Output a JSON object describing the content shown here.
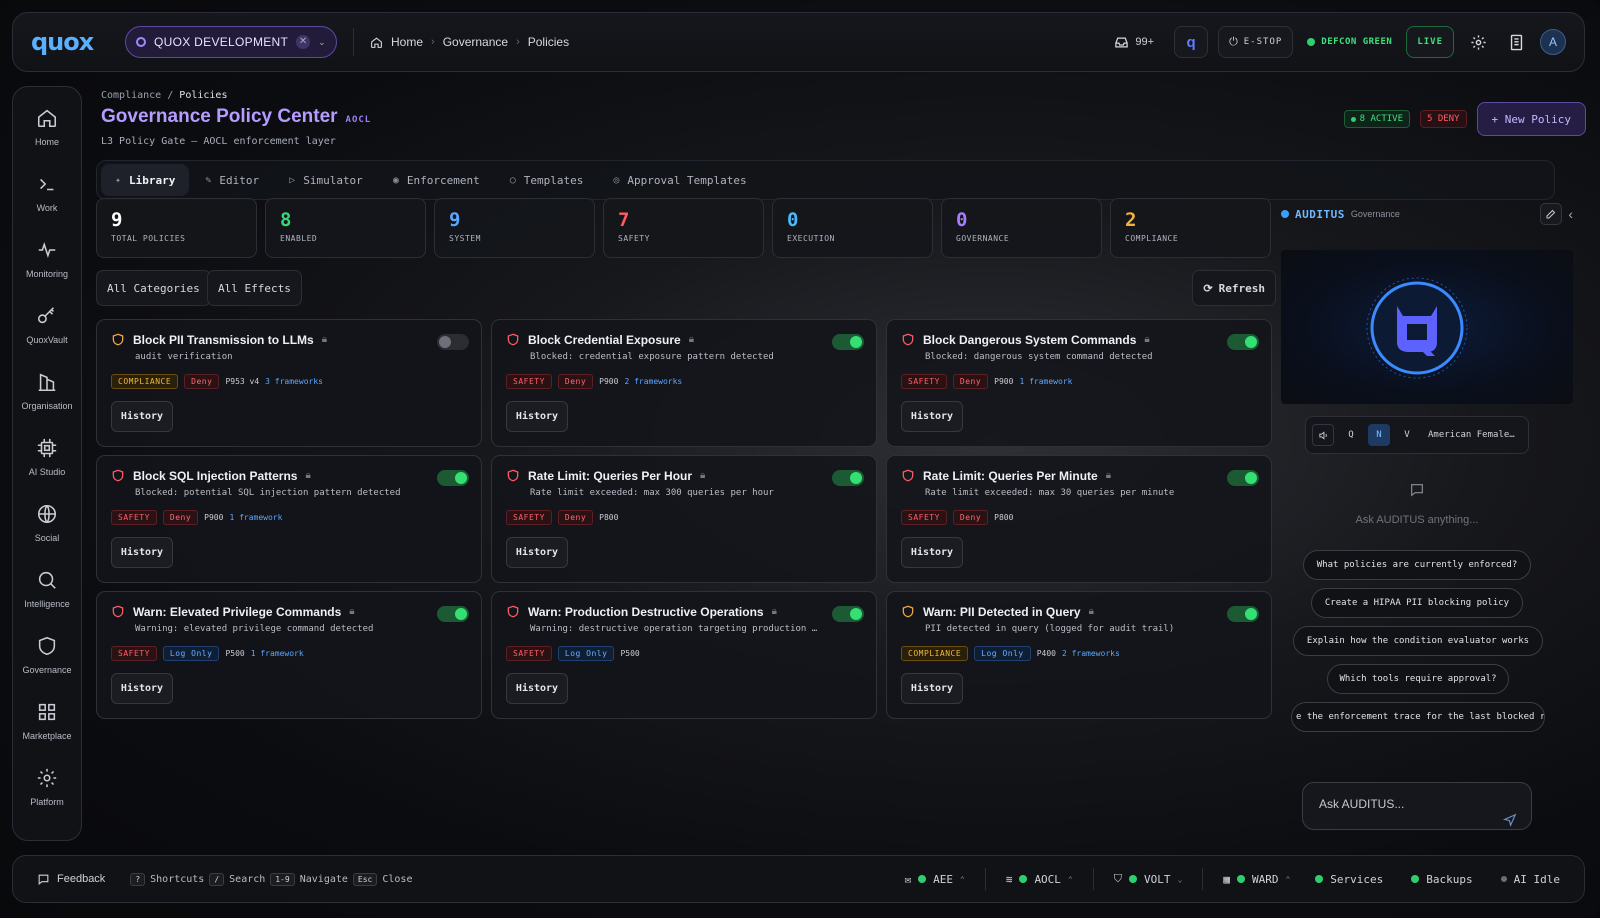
{
  "topbar": {
    "logo": "quox",
    "workspace": "QUOX DEVELOPMENT",
    "breadcrumbs": [
      "Home",
      "Governance",
      "Policies"
    ],
    "notifications": "99+",
    "estop": "E-STOP",
    "defcon": "DEFCON GREEN",
    "live": "LIVE",
    "avatar": "A"
  },
  "sidebar": {
    "items": [
      {
        "label": "Home",
        "icon": "home-icon"
      },
      {
        "label": "Work",
        "icon": "terminal-icon"
      },
      {
        "label": "Monitoring",
        "icon": "pulse-icon"
      },
      {
        "label": "QuoxVault",
        "icon": "key-icon"
      },
      {
        "label": "Organisation",
        "icon": "building-icon"
      },
      {
        "label": "AI Studio",
        "icon": "chip-icon"
      },
      {
        "label": "Social",
        "icon": "globe-icon"
      },
      {
        "label": "Intelligence",
        "icon": "search-icon"
      },
      {
        "label": "Governance",
        "icon": "shield-icon"
      },
      {
        "label": "Marketplace",
        "icon": "grid-icon"
      },
      {
        "label": "Platform",
        "icon": "gear-icon"
      }
    ]
  },
  "page": {
    "breadcrumb_parent": "Compliance",
    "breadcrumb_current": "Policies",
    "title": "Governance Policy Center",
    "title_tag": "AOCL",
    "subtitle": "L3 Policy Gate — AOCL enforcement layer",
    "active_badge": "8 ACTIVE",
    "deny_badge": "5 DENY",
    "new_policy": "+ New Policy"
  },
  "tabs": [
    {
      "label": "Library",
      "icon": "✦"
    },
    {
      "label": "Editor",
      "icon": "✎"
    },
    {
      "label": "Simulator",
      "icon": "▷"
    },
    {
      "label": "Enforcement",
      "icon": "◉"
    },
    {
      "label": "Templates",
      "icon": "○"
    },
    {
      "label": "Approval Templates",
      "icon": "◎"
    }
  ],
  "stats": [
    {
      "value": "9",
      "label": "TOTAL POLICIES",
      "color": "#ffffff"
    },
    {
      "value": "8",
      "label": "ENABLED",
      "color": "#35d874"
    },
    {
      "value": "9",
      "label": "SYSTEM",
      "color": "#59a8ff"
    },
    {
      "value": "7",
      "label": "SAFETY",
      "color": "#ff5a63"
    },
    {
      "value": "0",
      "label": "EXECUTION",
      "color": "#4ab8ff"
    },
    {
      "value": "0",
      "label": "GOVERNANCE",
      "color": "#a67dff"
    },
    {
      "value": "2",
      "label": "COMPLIANCE",
      "color": "#f2b23a"
    }
  ],
  "filters": {
    "categories": "All Categories",
    "effects": "All Effects",
    "refresh": "Refresh"
  },
  "policies": [
    {
      "title": "Block PII Transmission to LLMs",
      "desc": "audit verification",
      "category": "COMPLIANCE",
      "effect": "Deny",
      "code": "P953 v4",
      "frameworks": "3 frameworks",
      "enabled": false
    },
    {
      "title": "Block Credential Exposure",
      "desc": "Blocked: credential exposure pattern detected",
      "category": "SAFETY",
      "effect": "Deny",
      "code": "P900",
      "frameworks": "2 frameworks",
      "enabled": true
    },
    {
      "title": "Block Dangerous System Commands",
      "desc": "Blocked: dangerous system command detected",
      "category": "SAFETY",
      "effect": "Deny",
      "code": "P900",
      "frameworks": "1 framework",
      "enabled": true
    },
    {
      "title": "Block SQL Injection Patterns",
      "desc": "Blocked: potential SQL injection pattern detected",
      "category": "SAFETY",
      "effect": "Deny",
      "code": "P900",
      "frameworks": "1 framework",
      "enabled": true
    },
    {
      "title": "Rate Limit: Queries Per Hour",
      "desc": "Rate limit exceeded: max 300 queries per hour",
      "category": "SAFETY",
      "effect": "Deny",
      "code": "P800",
      "frameworks": "",
      "enabled": true
    },
    {
      "title": "Rate Limit: Queries Per Minute",
      "desc": "Rate limit exceeded: max 30 queries per minute",
      "category": "SAFETY",
      "effect": "Deny",
      "code": "P800",
      "frameworks": "",
      "enabled": true
    },
    {
      "title": "Warn: Elevated Privilege Commands",
      "desc": "Warning: elevated privilege command detected",
      "category": "SAFETY",
      "effect": "Log Only",
      "code": "P500",
      "frameworks": "1 framework",
      "enabled": true
    },
    {
      "title": "Warn: Production Destructive Operations",
      "desc": "Warning: destructive operation targeting production …",
      "category": "SAFETY",
      "effect": "Log Only",
      "code": "P500",
      "frameworks": "",
      "enabled": true
    },
    {
      "title": "Warn: PII Detected in Query",
      "desc": "PII detected in query (logged for audit trail)",
      "category": "COMPLIANCE",
      "effect": "Log Only",
      "code": "P400",
      "frameworks": "2 frameworks",
      "enabled": true
    }
  ],
  "history_label": "History",
  "auditus": {
    "name": "AUDITUS",
    "context": "Governance",
    "voice_keys": [
      "Q",
      "N",
      "V"
    ],
    "voice_name": "American Female…",
    "hint": "Ask AUDITUS anything...",
    "suggestions": [
      "What policies are currently enforced?",
      "Create a HIPAA PII blocking policy",
      "Explain how the condition evaluator works",
      "Which tools require approval?",
      "e the enforcement trace for the last blocked r"
    ],
    "input_placeholder": "Ask AUDITUS..."
  },
  "footer": {
    "feedback": "Feedback",
    "shortcuts": [
      {
        "key": "?",
        "label": "Shortcuts"
      },
      {
        "key": "/",
        "label": "Search"
      },
      {
        "key": "1-9",
        "label": "Navigate"
      },
      {
        "key": "Esc",
        "label": "Close"
      }
    ],
    "services": [
      {
        "label": "AEE",
        "icon": "mail-icon"
      },
      {
        "label": "AOCL",
        "icon": "layers-icon"
      },
      {
        "label": "VOLT",
        "icon": "shield-icon"
      },
      {
        "label": "WARD",
        "icon": "table-icon"
      }
    ],
    "status": [
      {
        "label": "Services",
        "color": "#2ed06e"
      },
      {
        "label": "Backups",
        "color": "#2ed06e"
      },
      {
        "label": "AI Idle",
        "color": "#6b6f78"
      }
    ]
  }
}
